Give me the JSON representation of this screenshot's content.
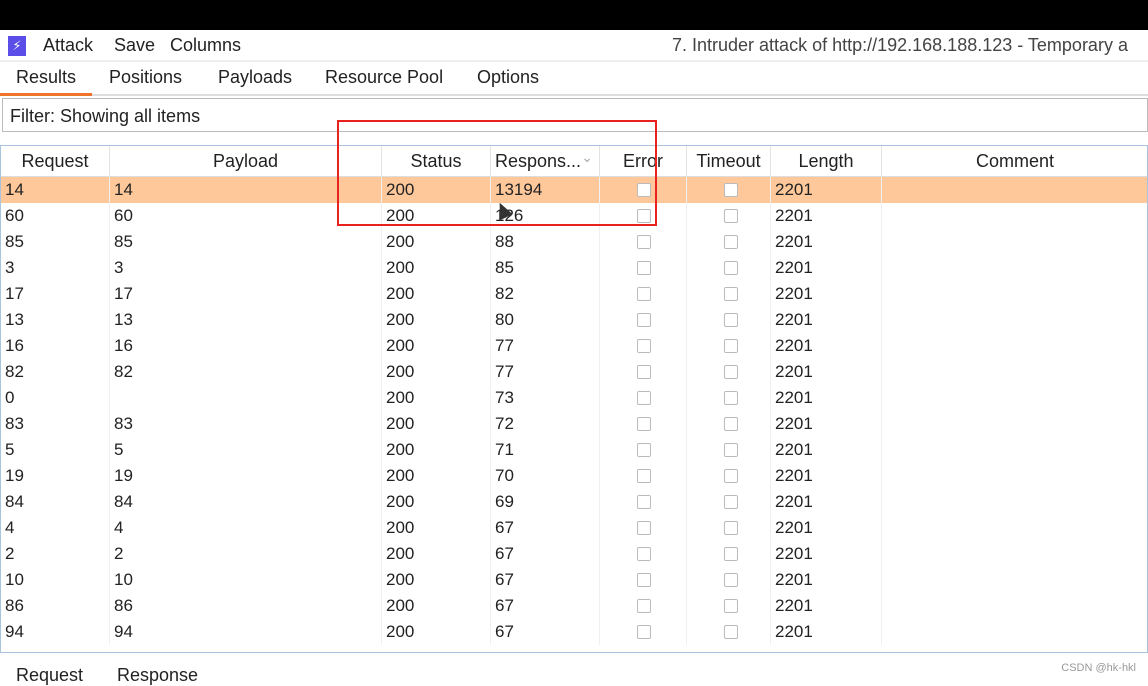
{
  "menubar": {
    "items": [
      "Attack",
      "Save",
      "Columns"
    ],
    "window_title": "7. Intruder attack of http://192.168.188.123 - Temporary a"
  },
  "tabs": [
    {
      "label": "Results",
      "active": true
    },
    {
      "label": "Positions"
    },
    {
      "label": "Payloads"
    },
    {
      "label": "Resource Pool"
    },
    {
      "label": "Options"
    }
  ],
  "filter": {
    "text": "Filter: Showing all items"
  },
  "table": {
    "columns": [
      "Request",
      "Payload",
      "Status",
      "Respons...",
      "Error",
      "Timeout",
      "Length",
      "Comment"
    ],
    "sort_column": "Respons...",
    "sort_direction": "descending",
    "selected_row": 0,
    "rows": [
      [
        "14",
        "14",
        "200",
        "13194",
        "2201"
      ],
      [
        "60",
        "60",
        "200",
        "126",
        "2201"
      ],
      [
        "85",
        "85",
        "200",
        "88",
        "2201"
      ],
      [
        "3",
        "3",
        "200",
        "85",
        "2201"
      ],
      [
        "17",
        "17",
        "200",
        "82",
        "2201"
      ],
      [
        "13",
        "13",
        "200",
        "80",
        "2201"
      ],
      [
        "16",
        "16",
        "200",
        "77",
        "2201"
      ],
      [
        "82",
        "82",
        "200",
        "77",
        "2201"
      ],
      [
        "0",
        "",
        "200",
        "73",
        "2201"
      ],
      [
        "83",
        "83",
        "200",
        "72",
        "2201"
      ],
      [
        "5",
        "5",
        "200",
        "71",
        "2201"
      ],
      [
        "19",
        "19",
        "200",
        "70",
        "2201"
      ],
      [
        "84",
        "84",
        "200",
        "69",
        "2201"
      ],
      [
        "4",
        "4",
        "200",
        "67",
        "2201"
      ],
      [
        "2",
        "2",
        "200",
        "67",
        "2201"
      ],
      [
        "10",
        "10",
        "200",
        "67",
        "2201"
      ],
      [
        "86",
        "86",
        "200",
        "67",
        "2201"
      ],
      [
        "94",
        "94",
        "200",
        "67",
        "2201"
      ]
    ]
  },
  "bottom_tabs": [
    "Request",
    "Response"
  ],
  "watermark": "CSDN @hk-hkl",
  "colors": {
    "selected_row": "#ffc89a",
    "active_tab": "#f0732a",
    "highlight_box": "#e8231d"
  }
}
